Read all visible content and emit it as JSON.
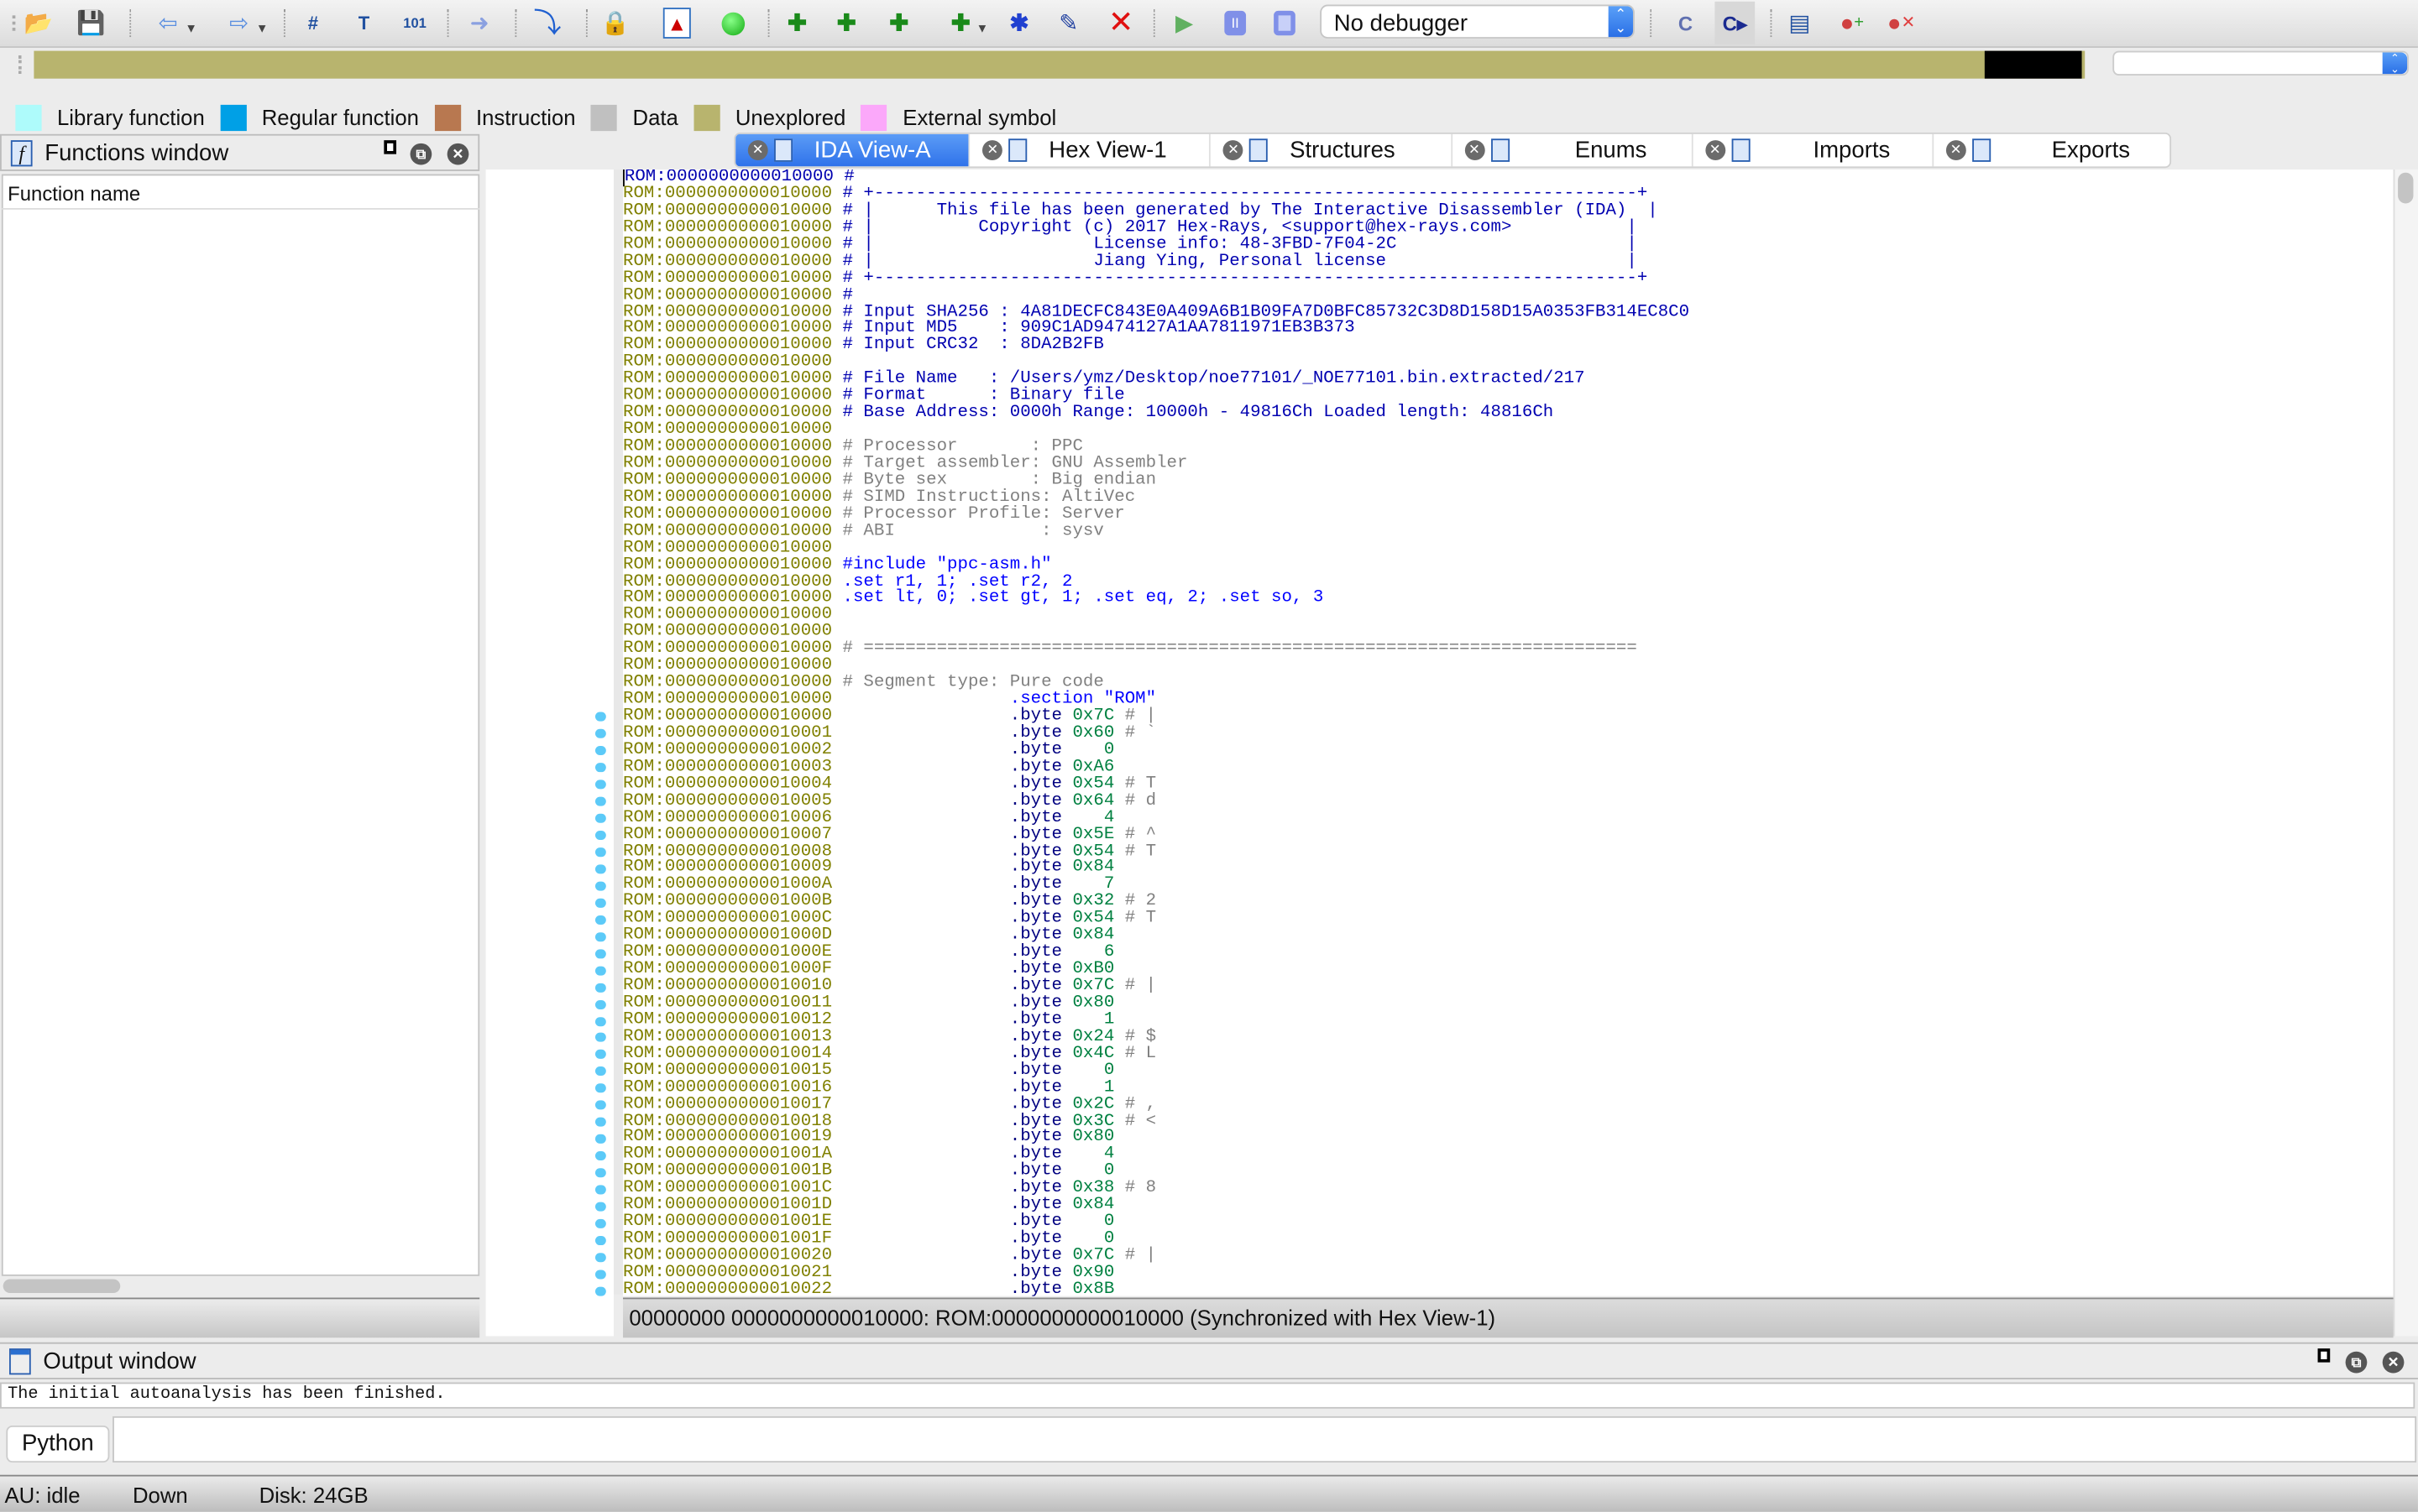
{
  "toolbar": {
    "debugger_select": "No debugger",
    "icons": [
      "open-file-icon",
      "save-icon",
      "back-icon",
      "forward-icon",
      "search-binary-icon",
      "search-text-icon",
      "search-immediate-icon",
      "jump-icon",
      "jump-down-icon",
      "lock-icon",
      "graph-icon",
      "run-icon",
      "create-code-icon",
      "create-data-icon",
      "create-string-icon",
      "create-struct-icon",
      "create-enum-icon",
      "edit-icon",
      "undefine-icon",
      "start-debug-icon",
      "pause-icon",
      "stop-icon",
      "decompile-icon",
      "decompile-run-icon",
      "breakpoint-list-icon",
      "add-breakpoint-icon",
      "delete-breakpoint-icon"
    ]
  },
  "navband": {
    "colors": {
      "unexplored": "#b8b46e",
      "cursor": "#000000"
    },
    "segment_combo": ""
  },
  "legend": [
    {
      "label": "Library function",
      "color": "#aefbfb"
    },
    {
      "label": "Regular function",
      "color": "#00a0e6"
    },
    {
      "label": "Instruction",
      "color": "#b87850"
    },
    {
      "label": "Data",
      "color": "#c0c0c0"
    },
    {
      "label": "Unexplored",
      "color": "#b8b46e"
    },
    {
      "label": "External symbol",
      "color": "#fba8fa"
    }
  ],
  "functions_window": {
    "title": "Functions window",
    "column": "Function name"
  },
  "tabs": [
    {
      "label": "IDA View-A",
      "active": true
    },
    {
      "label": "Hex View-1",
      "active": false
    },
    {
      "label": "Structures",
      "active": false
    },
    {
      "label": "Enums",
      "active": false
    },
    {
      "label": "Imports",
      "active": false
    },
    {
      "label": "Exports",
      "active": false
    }
  ],
  "disasm": {
    "header_lines": [
      {
        "addr": "ROM:0000000000010000",
        "text": " #",
        "cls": "cm"
      },
      {
        "addr": "ROM:0000000000010000",
        "text": " # +-------------------------------------------------------------------------+",
        "cls": "cm"
      },
      {
        "addr": "ROM:0000000000010000",
        "text": " # |      This file has been generated by The Interactive Disassembler (IDA)  |",
        "cls": "cm"
      },
      {
        "addr": "ROM:0000000000010000",
        "text": " # |          Copyright (c) 2017 Hex-Rays, <support@hex-rays.com>           |",
        "cls": "cm"
      },
      {
        "addr": "ROM:0000000000010000",
        "text": " # |                     License info: 48-3FBD-7F04-2C                      |",
        "cls": "cm"
      },
      {
        "addr": "ROM:0000000000010000",
        "text": " # |                     Jiang Ying, Personal license                       |",
        "cls": "cm"
      },
      {
        "addr": "ROM:0000000000010000",
        "text": " # +-------------------------------------------------------------------------+",
        "cls": "cm"
      },
      {
        "addr": "ROM:0000000000010000",
        "text": " #",
        "cls": "cm"
      },
      {
        "addr": "ROM:0000000000010000",
        "text": " # Input SHA256 : 4A81DECFC843E0A409A6B1B09FA7D0BFC85732C3D8D158D15A0353FB314EC8C0",
        "cls": "cm"
      },
      {
        "addr": "ROM:0000000000010000",
        "text": " # Input MD5    : 909C1AD9474127A1AA7811971EB3B373",
        "cls": "cm"
      },
      {
        "addr": "ROM:0000000000010000",
        "text": " # Input CRC32  : 8DA2B2FB",
        "cls": "cm"
      },
      {
        "addr": "ROM:0000000000010000",
        "text": "",
        "cls": "cm"
      },
      {
        "addr": "ROM:0000000000010000",
        "text": " # File Name   : /Users/ymz/Desktop/noe77101/_NOE77101.bin.extracted/217",
        "cls": "cm"
      },
      {
        "addr": "ROM:0000000000010000",
        "text": " # Format      : Binary file",
        "cls": "cm"
      },
      {
        "addr": "ROM:0000000000010000",
        "text": " # Base Address: 0000h Range: 10000h - 49816Ch Loaded length: 48816Ch",
        "cls": "cm"
      },
      {
        "addr": "ROM:0000000000010000",
        "text": "",
        "cls": "gr"
      },
      {
        "addr": "ROM:0000000000010000",
        "text": " # Processor       : PPC",
        "cls": "gr"
      },
      {
        "addr": "ROM:0000000000010000",
        "text": " # Target assembler: GNU Assembler",
        "cls": "gr"
      },
      {
        "addr": "ROM:0000000000010000",
        "text": " # Byte sex        : Big endian",
        "cls": "gr"
      },
      {
        "addr": "ROM:0000000000010000",
        "text": " # SIMD Instructions: AltiVec",
        "cls": "gr"
      },
      {
        "addr": "ROM:0000000000010000",
        "text": " # Processor Profile: Server",
        "cls": "gr"
      },
      {
        "addr": "ROM:0000000000010000",
        "text": " # ABI              : sysv",
        "cls": "gr"
      },
      {
        "addr": "ROM:0000000000010000",
        "text": "",
        "cls": "gr"
      },
      {
        "addr": "ROM:0000000000010000",
        "text": " #include \"ppc-asm.h\"",
        "cls": "str"
      },
      {
        "addr": "ROM:0000000000010000",
        "text": " .set r1, 1; .set r2, 2",
        "cls": "str"
      },
      {
        "addr": "ROM:0000000000010000",
        "text": " .set lt, 0; .set gt, 1; .set eq, 2; .set so, 3",
        "cls": "str"
      },
      {
        "addr": "ROM:0000000000010000",
        "text": "",
        "cls": "gr"
      },
      {
        "addr": "ROM:0000000000010000",
        "text": "",
        "cls": "gr"
      },
      {
        "addr": "ROM:0000000000010000",
        "text": " # ==========================================================================",
        "cls": "gr"
      },
      {
        "addr": "ROM:0000000000010000",
        "text": "",
        "cls": "gr"
      },
      {
        "addr": "ROM:0000000000010000",
        "text": " # Segment type: Pure code",
        "cls": "gr"
      },
      {
        "addr": "ROM:0000000000010000",
        "text": "                 .section \"ROM\"",
        "cls": "str"
      }
    ],
    "byte_lines": [
      {
        "addr": "ROM:0000000000010000",
        "value": "0x7C",
        "comment": "# |"
      },
      {
        "addr": "ROM:0000000000010001",
        "value": "0x60",
        "comment": "# `"
      },
      {
        "addr": "ROM:0000000000010002",
        "value": "   0",
        "comment": ""
      },
      {
        "addr": "ROM:0000000000010003",
        "value": "0xA6",
        "comment": ""
      },
      {
        "addr": "ROM:0000000000010004",
        "value": "0x54",
        "comment": "# T"
      },
      {
        "addr": "ROM:0000000000010005",
        "value": "0x64",
        "comment": "# d"
      },
      {
        "addr": "ROM:0000000000010006",
        "value": "   4",
        "comment": ""
      },
      {
        "addr": "ROM:0000000000010007",
        "value": "0x5E",
        "comment": "# ^"
      },
      {
        "addr": "ROM:0000000000010008",
        "value": "0x54",
        "comment": "# T"
      },
      {
        "addr": "ROM:0000000000010009",
        "value": "0x84",
        "comment": ""
      },
      {
        "addr": "ROM:000000000001000A",
        "value": "   7",
        "comment": ""
      },
      {
        "addr": "ROM:000000000001000B",
        "value": "0x32",
        "comment": "# 2"
      },
      {
        "addr": "ROM:000000000001000C",
        "value": "0x54",
        "comment": "# T"
      },
      {
        "addr": "ROM:000000000001000D",
        "value": "0x84",
        "comment": ""
      },
      {
        "addr": "ROM:000000000001000E",
        "value": "   6",
        "comment": ""
      },
      {
        "addr": "ROM:000000000001000F",
        "value": "0xB0",
        "comment": ""
      },
      {
        "addr": "ROM:0000000000010010",
        "value": "0x7C",
        "comment": "# |"
      },
      {
        "addr": "ROM:0000000000010011",
        "value": "0x80",
        "comment": ""
      },
      {
        "addr": "ROM:0000000000010012",
        "value": "   1",
        "comment": ""
      },
      {
        "addr": "ROM:0000000000010013",
        "value": "0x24",
        "comment": "# $"
      },
      {
        "addr": "ROM:0000000000010014",
        "value": "0x4C",
        "comment": "# L"
      },
      {
        "addr": "ROM:0000000000010015",
        "value": "   0",
        "comment": ""
      },
      {
        "addr": "ROM:0000000000010016",
        "value": "   1",
        "comment": ""
      },
      {
        "addr": "ROM:0000000000010017",
        "value": "0x2C",
        "comment": "# ,"
      },
      {
        "addr": "ROM:0000000000010018",
        "value": "0x3C",
        "comment": "# <"
      },
      {
        "addr": "ROM:0000000000010019",
        "value": "0x80",
        "comment": ""
      },
      {
        "addr": "ROM:000000000001001A",
        "value": "   4",
        "comment": ""
      },
      {
        "addr": "ROM:000000000001001B",
        "value": "   0",
        "comment": ""
      },
      {
        "addr": "ROM:000000000001001C",
        "value": "0x38",
        "comment": "# 8"
      },
      {
        "addr": "ROM:000000000001001D",
        "value": "0x84",
        "comment": ""
      },
      {
        "addr": "ROM:000000000001001E",
        "value": "   0",
        "comment": ""
      },
      {
        "addr": "ROM:000000000001001F",
        "value": "   0",
        "comment": ""
      },
      {
        "addr": "ROM:0000000000010020",
        "value": "0x7C",
        "comment": "# |"
      },
      {
        "addr": "ROM:0000000000010021",
        "value": "0x90",
        "comment": ""
      },
      {
        "addr": "ROM:0000000000010022",
        "value": "0x8B",
        "comment": ""
      }
    ],
    "byte_directive": ".byte",
    "status": "00000000  0000000000010000: ROM:0000000000010000  (Synchronized with Hex View-1)"
  },
  "output_window": {
    "title": "Output window",
    "message": "The initial autoanalysis has been finished.",
    "cli_button": "Python",
    "cli_input": ""
  },
  "statusbar": {
    "au": "AU:  idle",
    "direction": "Down",
    "disk": "Disk: 24GB"
  }
}
